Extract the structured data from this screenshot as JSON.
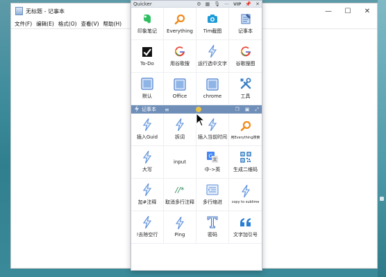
{
  "notepad": {
    "title": "无标题 - 记事本",
    "menus": [
      "文件(F)",
      "编辑(E)",
      "格式(O)",
      "查看(V)",
      "帮助(H)"
    ],
    "controls": [
      "—",
      "☐",
      "✕"
    ]
  },
  "quicker": {
    "title": "Quicker",
    "vip": "VIP",
    "titlebar_icons": [
      "gear-icon",
      "qrcode-icon",
      "microphone-icon",
      "more-icon",
      "pin-icon",
      "close-icon"
    ],
    "top_actions": [
      {
        "label": "印象笔记",
        "icon": "evernote-icon",
        "color": "#2dbe60"
      },
      {
        "label": "Everything",
        "icon": "search-icon",
        "color": "#f08a1c"
      },
      {
        "label": "Tim截图",
        "icon": "camera-icon",
        "color": "#1e9bd7"
      },
      {
        "label": "记事本",
        "icon": "notepad-icon",
        "color": "#4a78c2"
      },
      {
        "label": "To-Do",
        "icon": "checkbox-icon",
        "color": "#111111"
      },
      {
        "label": "用谷歌搜",
        "icon": "google-icon",
        "color": "#4285f4"
      },
      {
        "label": "运行选中文字",
        "icon": "lightning-icon",
        "color": "#5b8fd9"
      },
      {
        "label": "谷歌搜图",
        "icon": "google-icon",
        "color": "#4285f4"
      },
      {
        "label": "默认",
        "icon": "window-icon",
        "color": "#4b7fd0"
      },
      {
        "label": "Office",
        "icon": "window-icon",
        "color": "#4b7fd0"
      },
      {
        "label": "chrome",
        "icon": "window-icon",
        "color": "#4b7fd0"
      },
      {
        "label": "工具",
        "icon": "tools-icon",
        "color": "#3a7fc4"
      }
    ],
    "section2": {
      "title": "记事本",
      "mid": "≡",
      "icons": [
        "copy-icon",
        "clipboard-icon",
        "expand-icon"
      ]
    },
    "bottom_actions": [
      {
        "label": "插入Guid",
        "icon": "lightning-icon",
        "color": "#5b8fd9"
      },
      {
        "label": "拆词",
        "icon": "lightning-icon",
        "color": "#5b8fd9"
      },
      {
        "label": "插入当前时间",
        "icon": "lightning-icon",
        "color": "#5b8fd9"
      },
      {
        "label": "用Everything搜索",
        "icon": "search-icon",
        "color": "#f08a1c"
      },
      {
        "label": "大写",
        "icon": "lightning-icon",
        "color": "#5b8fd9"
      },
      {
        "label": "input",
        "icon": "",
        "color": "#333333"
      },
      {
        "label": "中->英",
        "icon": "translate-icon",
        "color": "#4285f4"
      },
      {
        "label": "生成二维码",
        "icon": "qrcode-icon",
        "color": "#1e6fbf"
      },
      {
        "label": "加#注释",
        "icon": "lightning-icon",
        "color": "#5b8fd9"
      },
      {
        "label": "取消多行注释",
        "icon": "hash-comment-icon",
        "color": "#2e8b57"
      },
      {
        "label": "多行缩进",
        "icon": "indent-icon",
        "color": "#5b8fd9"
      },
      {
        "label": "copy to sublime",
        "icon": "lightning-icon",
        "color": "#5b8fd9"
      },
      {
        "label": "!去除空行",
        "icon": "lightning-icon",
        "color": "#5b8fd9"
      },
      {
        "label": "Ping",
        "icon": "lightning-icon",
        "color": "#5b8fd9"
      },
      {
        "label": "密码",
        "icon": "text-t-icon",
        "color": "#4a78c2"
      },
      {
        "label": "文字加引号",
        "icon": "quote-icon",
        "color": "#2a7fd4"
      }
    ]
  }
}
